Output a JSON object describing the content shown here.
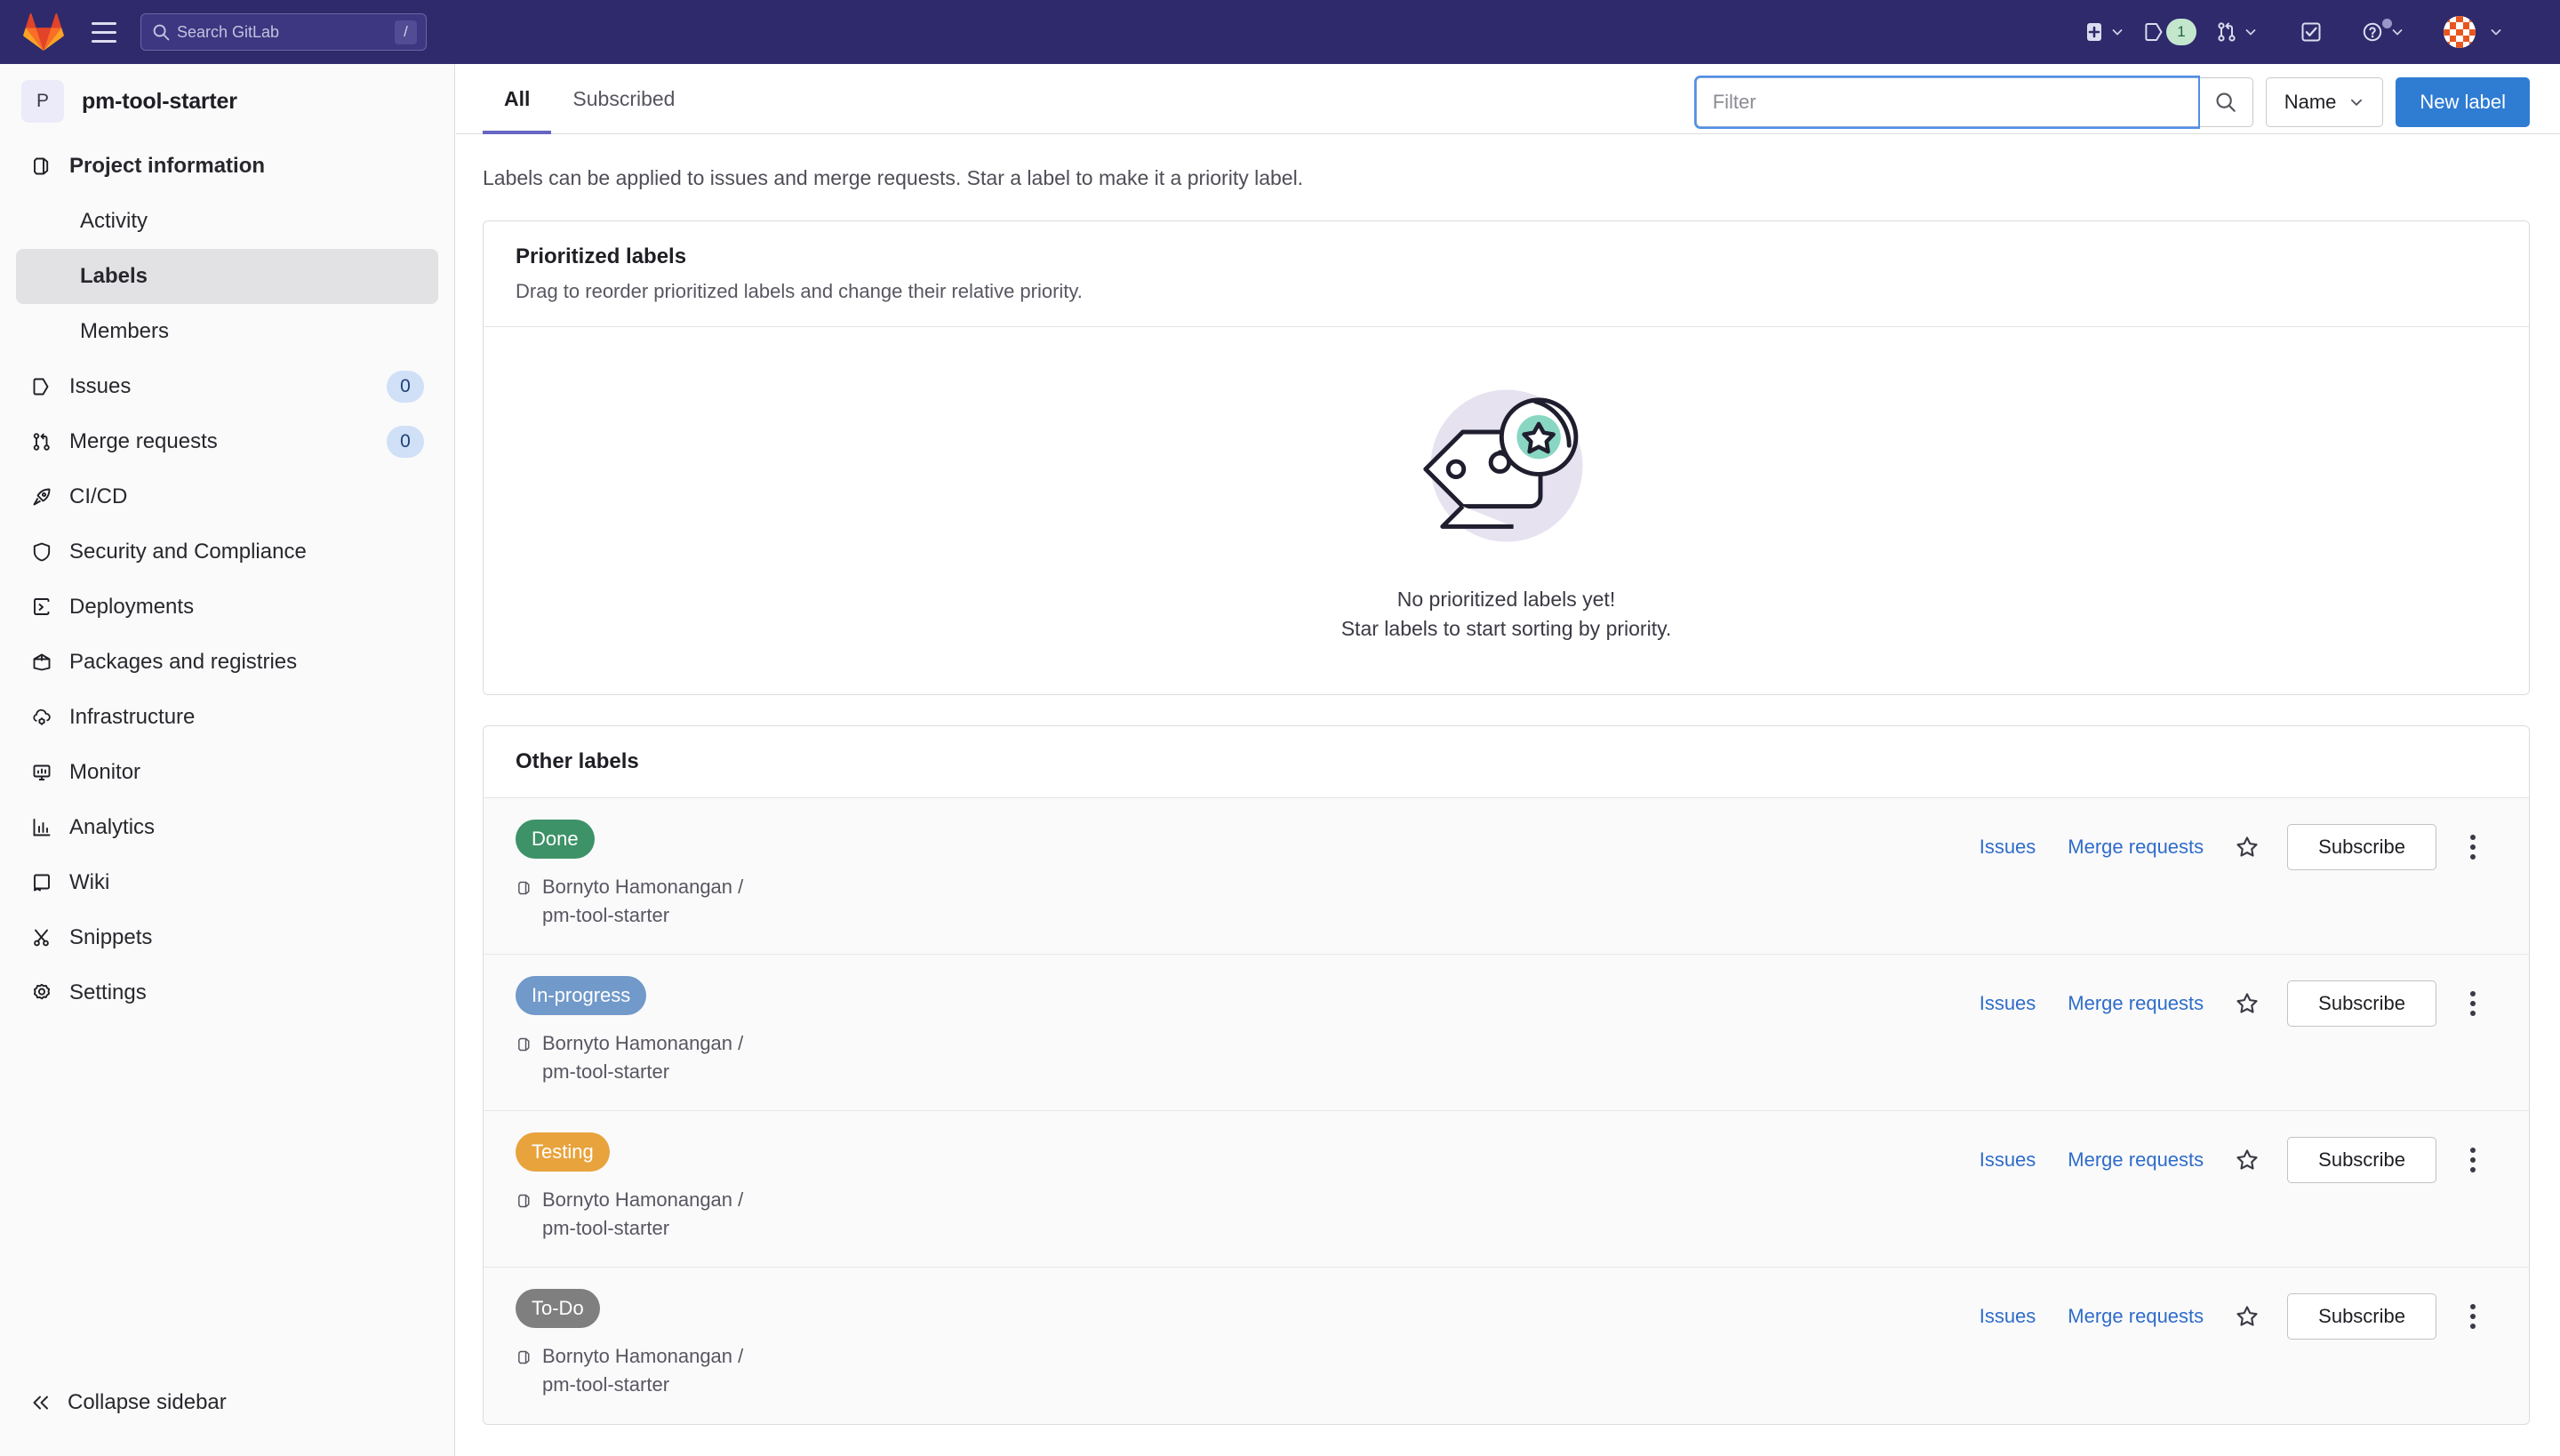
{
  "navbar": {
    "logo_icon": "gitlab-logo-icon",
    "menu_icon": "hamburger-menu-icon",
    "search": {
      "placeholder": "Search GitLab",
      "value": "",
      "icon": "search-icon",
      "shortcut": "/"
    },
    "actions": [
      {
        "name": "create-new",
        "icon": "plus-square-icon",
        "caret": true,
        "badge": null
      },
      {
        "name": "issues",
        "icon": "issue-icon",
        "caret": false,
        "badge": "1"
      },
      {
        "name": "merge-requests",
        "icon": "merge-request-icon",
        "caret": true,
        "badge": null
      },
      {
        "name": "todos",
        "icon": "todo-check-icon",
        "caret": false,
        "badge": null
      },
      {
        "name": "help",
        "icon": "question-circle-icon",
        "caret": true,
        "badge": null
      },
      {
        "name": "user-menu",
        "icon": "avatar-icon",
        "caret": true,
        "badge": null
      }
    ]
  },
  "sidebar": {
    "project": {
      "initial": "P",
      "name": "pm-tool-starter"
    },
    "items": [
      {
        "label": "Project information",
        "icon": "project-icon",
        "bold": true,
        "sub": false,
        "active": false,
        "badge": null
      },
      {
        "label": "Activity",
        "icon": "",
        "bold": false,
        "sub": true,
        "active": false,
        "badge": null
      },
      {
        "label": "Labels",
        "icon": "",
        "bold": false,
        "sub": true,
        "active": true,
        "badge": null
      },
      {
        "label": "Members",
        "icon": "",
        "bold": false,
        "sub": true,
        "active": false,
        "badge": null
      },
      {
        "label": "Issues",
        "icon": "issue-icon",
        "bold": false,
        "sub": false,
        "active": false,
        "badge": "0"
      },
      {
        "label": "Merge requests",
        "icon": "merge-request-icon",
        "bold": false,
        "sub": false,
        "active": false,
        "badge": "0"
      },
      {
        "label": "CI/CD",
        "icon": "rocket-icon",
        "bold": false,
        "sub": false,
        "active": false,
        "badge": null
      },
      {
        "label": "Security and Compliance",
        "icon": "shield-icon",
        "bold": false,
        "sub": false,
        "active": false,
        "badge": null
      },
      {
        "label": "Deployments",
        "icon": "deployments-icon",
        "bold": false,
        "sub": false,
        "active": false,
        "badge": null
      },
      {
        "label": "Packages and registries",
        "icon": "package-icon",
        "bold": false,
        "sub": false,
        "active": false,
        "badge": null
      },
      {
        "label": "Infrastructure",
        "icon": "cloud-gear-icon",
        "bold": false,
        "sub": false,
        "active": false,
        "badge": null
      },
      {
        "label": "Monitor",
        "icon": "monitor-icon",
        "bold": false,
        "sub": false,
        "active": false,
        "badge": null
      },
      {
        "label": "Analytics",
        "icon": "chart-icon",
        "bold": false,
        "sub": false,
        "active": false,
        "badge": null
      },
      {
        "label": "Wiki",
        "icon": "book-icon",
        "bold": false,
        "sub": false,
        "active": false,
        "badge": null
      },
      {
        "label": "Snippets",
        "icon": "snippet-icon",
        "bold": false,
        "sub": false,
        "active": false,
        "badge": null
      },
      {
        "label": "Settings",
        "icon": "gear-icon",
        "bold": false,
        "sub": false,
        "active": false,
        "badge": null
      }
    ],
    "collapse_label": "Collapse sidebar",
    "collapse_icon": "chevron-double-left-icon"
  },
  "main": {
    "tabs": [
      {
        "label": "All",
        "active": true
      },
      {
        "label": "Subscribed",
        "active": false
      }
    ],
    "filter": {
      "placeholder": "Filter",
      "value": "",
      "search_icon": "search-icon"
    },
    "sort": {
      "label": "Name",
      "caret_icon": "chevron-down-icon"
    },
    "new_label_button": "New label",
    "description": "Labels can be applied to issues and merge requests. Star a label to make it a priority label.",
    "prioritized": {
      "title": "Prioritized labels",
      "subtitle": "Drag to reorder prioritized labels and change their relative priority.",
      "empty_title": "No prioritized labels yet!",
      "empty_subtitle": "Star labels to start sorting by priority.",
      "illustration_icon": "tag-with-star-illustration"
    },
    "other_labels": {
      "title": "Other labels",
      "row_actions": {
        "issues": "Issues",
        "merge_requests": "Merge requests",
        "star_icon": "star-outline-icon",
        "subscribe": "Subscribe",
        "kebab_icon": "ellipsis-vertical-icon"
      },
      "rows": [
        {
          "name": "Done",
          "color": "#3d9268",
          "text_color": "#ffffff",
          "path": "Bornyto Hamonangan / pm-tool-starter",
          "path_icon": "project-icon"
        },
        {
          "name": "In-progress",
          "color": "#7199c9",
          "text_color": "#ffffff",
          "path": "Bornyto Hamonangan / pm-tool-starter",
          "path_icon": "project-icon"
        },
        {
          "name": "Testing",
          "color": "#e8a33d",
          "text_color": "#ffffff",
          "path": "Bornyto Hamonangan / pm-tool-starter",
          "path_icon": "project-icon"
        },
        {
          "name": "To-Do",
          "color": "#7f7f7f",
          "text_color": "#ffffff",
          "path": "Bornyto Hamonangan / pm-tool-starter",
          "path_icon": "project-icon"
        }
      ]
    }
  },
  "colors": {
    "navbar_bg": "#2f2a6b",
    "primary_button": "#2f7cd3",
    "link": "#2f6cc9",
    "active_tab_underline": "#6666c4",
    "sidebar_bg": "#fafafa"
  }
}
